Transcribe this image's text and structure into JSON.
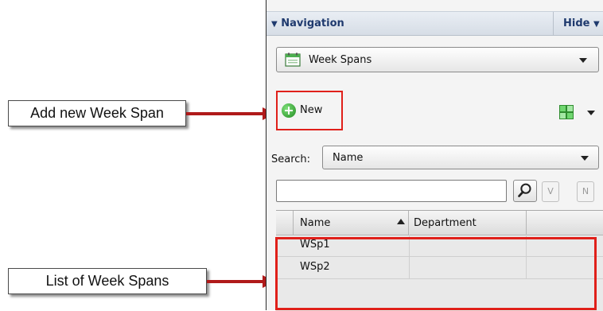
{
  "callouts": {
    "add_new": "Add new Week Span",
    "list": "List of Week Spans"
  },
  "navigation": {
    "title": "Navigation",
    "hide_label": "Hide"
  },
  "view_selector": {
    "value": "Week Spans",
    "icon": "calendar-icon"
  },
  "toolbar": {
    "new_label": "New",
    "new_icon": "plus-circle-icon",
    "view_icon": "grid-view-icon"
  },
  "search": {
    "label": "Search:",
    "field_value": "Name",
    "input_value": "",
    "button_v": "V",
    "button_n": "N"
  },
  "grid": {
    "columns": [
      "Name",
      "Department"
    ],
    "rows": [
      {
        "name": "WSp1",
        "department": ""
      },
      {
        "name": "WSp2",
        "department": ""
      }
    ]
  },
  "colors": {
    "accent": "#e0201a",
    "arrow": "#b01a1a",
    "header_text": "#1f3a6e"
  }
}
